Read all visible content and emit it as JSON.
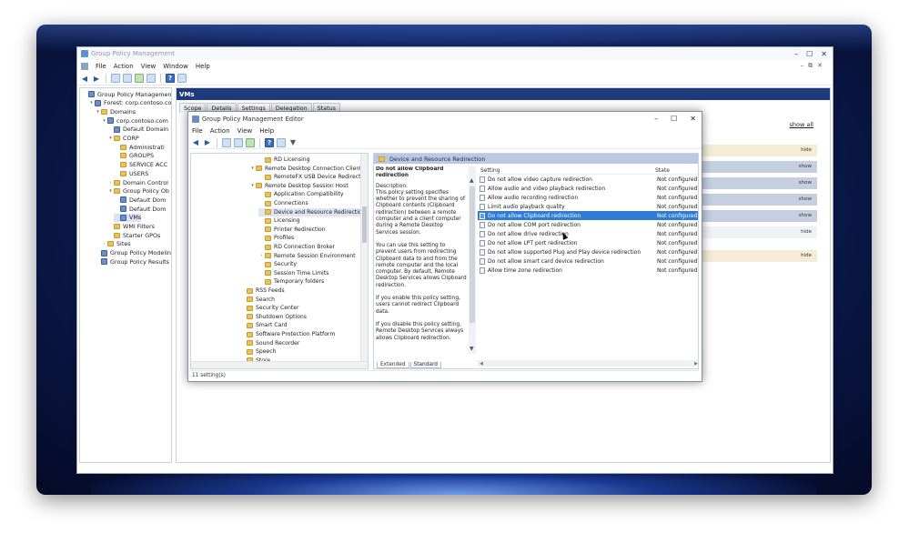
{
  "gpm": {
    "title": "Group Policy Management",
    "menu": [
      "File",
      "Action",
      "View",
      "Window",
      "Help"
    ],
    "tree": [
      {
        "label": "Group Policy Management",
        "icon": "gpm-icon",
        "exp": ""
      },
      {
        "label": "Forest: corp.contoso.com",
        "icon": "forest-icon",
        "exp": "▾"
      },
      {
        "label": "Domains",
        "icon": "folder-icon",
        "exp": "▾"
      },
      {
        "label": "corp.contoso.com",
        "icon": "domain-icon",
        "exp": "▾"
      },
      {
        "label": "Default Domain",
        "icon": "gpo-icon",
        "exp": ""
      },
      {
        "label": "CORP",
        "icon": "folder-icon",
        "exp": "▾"
      },
      {
        "label": "Administrati",
        "icon": "folder-icon",
        "exp": ""
      },
      {
        "label": "GROUPS",
        "icon": "folder-icon",
        "exp": ""
      },
      {
        "label": "SERVICE ACC",
        "icon": "folder-icon",
        "exp": ""
      },
      {
        "label": "USERS",
        "icon": "folder-icon",
        "exp": ""
      },
      {
        "label": "Domain Control",
        "icon": "folder-icon",
        "exp": "›"
      },
      {
        "label": "Group Policy Ob",
        "icon": "folder-icon",
        "exp": "▾"
      },
      {
        "label": "Default Dom",
        "icon": "gpo-icon",
        "exp": ""
      },
      {
        "label": "Default Dom",
        "icon": "gpo-icon",
        "exp": ""
      },
      {
        "label": "VMs",
        "icon": "gpo-icon",
        "exp": ""
      },
      {
        "label": "WMI Filters",
        "icon": "folder-icon",
        "exp": ""
      },
      {
        "label": "Starter GPOs",
        "icon": "folder-icon",
        "exp": ""
      },
      {
        "label": "Sites",
        "icon": "folder-icon",
        "exp": "›"
      },
      {
        "label": "Group Policy Modeling",
        "icon": "gpo-icon",
        "exp": ""
      },
      {
        "label": "Group Policy Results",
        "icon": "gpo-icon",
        "exp": ""
      }
    ],
    "right": {
      "header": "VMs",
      "tabs": [
        "Scope",
        "Details",
        "Settings",
        "Delegation",
        "Status"
      ],
      "active_tab": "Settings",
      "show_all": "show all",
      "report_rows": [
        {
          "text": "hide",
          "kind": "h"
        },
        {
          "text": "show",
          "kind": "b"
        },
        {
          "text": "show",
          "kind": "b"
        },
        {
          "text": "show",
          "kind": "b"
        },
        {
          "text": "show",
          "kind": "b"
        },
        {
          "text": "hide",
          "kind": "w"
        },
        {
          "text": "hide",
          "kind": "h"
        }
      ]
    }
  },
  "gpme": {
    "title": "Group Policy Management Editor",
    "menu": [
      "File",
      "Action",
      "View",
      "Help"
    ],
    "tree": [
      {
        "label": "RD Licensing",
        "indent": 2,
        "exp": ""
      },
      {
        "label": "Remote Desktop Connection Client",
        "indent": 1,
        "exp": "▾"
      },
      {
        "label": "RemoteFX USB Device Redirection",
        "indent": 2,
        "exp": ""
      },
      {
        "label": "Remote Desktop Session Host",
        "indent": 1,
        "exp": "▾"
      },
      {
        "label": "Application Compatibility",
        "indent": 2,
        "exp": ""
      },
      {
        "label": "Connections",
        "indent": 2,
        "exp": ""
      },
      {
        "label": "Device and Resource Redirection",
        "indent": 2,
        "exp": "",
        "selected": true
      },
      {
        "label": "Licensing",
        "indent": 2,
        "exp": ""
      },
      {
        "label": "Printer Redirection",
        "indent": 2,
        "exp": ""
      },
      {
        "label": "Profiles",
        "indent": 2,
        "exp": ""
      },
      {
        "label": "RD Connection Broker",
        "indent": 2,
        "exp": ""
      },
      {
        "label": "Remote Session Environment",
        "indent": 2,
        "exp": "›"
      },
      {
        "label": "Security",
        "indent": 2,
        "exp": ""
      },
      {
        "label": "Session Time Limits",
        "indent": 2,
        "exp": ""
      },
      {
        "label": "Temporary folders",
        "indent": 2,
        "exp": ""
      },
      {
        "label": "RSS Feeds",
        "indent": 0,
        "exp": ""
      },
      {
        "label": "Search",
        "indent": 0,
        "exp": ""
      },
      {
        "label": "Security Center",
        "indent": 0,
        "exp": ""
      },
      {
        "label": "Shutdown Options",
        "indent": 0,
        "exp": ""
      },
      {
        "label": "Smart Card",
        "indent": 0,
        "exp": ""
      },
      {
        "label": "Software Protection Platform",
        "indent": 0,
        "exp": ""
      },
      {
        "label": "Sound Recorder",
        "indent": 0,
        "exp": ""
      },
      {
        "label": "Speech",
        "indent": 0,
        "exp": ""
      },
      {
        "label": "Store",
        "indent": 0,
        "exp": ""
      }
    ],
    "section_title": "Device and Resource Redirection",
    "description": {
      "title": "Do not allow Clipboard redirection",
      "paragraphs": [
        "Description:\nThis policy setting specifies whether to prevent the sharing of Clipboard contents (Clipboard redirection) between a remote computer and a client computer during a Remote Desktop Services session.",
        "You can use this setting to prevent users from redirecting Clipboard data to and from the remote computer and the local computer. By default, Remote Desktop Services allows Clipboard redirection.",
        "If you enable this policy setting, users cannot redirect Clipboard data.",
        "If you disable this policy setting, Remote Desktop Services always allows Clipboard redirection."
      ]
    },
    "columns": {
      "setting": "Setting",
      "state": "State"
    },
    "settings": [
      {
        "name": "Do not allow video capture redirection",
        "state": "Not configured"
      },
      {
        "name": "Allow audio and video playback redirection",
        "state": "Not configured"
      },
      {
        "name": "Allow audio recording redirection",
        "state": "Not configured"
      },
      {
        "name": "Limit audio playback quality",
        "state": "Not configured"
      },
      {
        "name": "Do not allow Clipboard redirection",
        "state": "Not configured",
        "selected": true
      },
      {
        "name": "Do not allow COM port redirection",
        "state": "Not configured"
      },
      {
        "name": "Do not allow drive redirection",
        "state": "Not configured"
      },
      {
        "name": "Do not allow LPT port redirection",
        "state": "Not configured"
      },
      {
        "name": "Do not allow supported Plug and Play device redirection",
        "state": "Not configured"
      },
      {
        "name": "Do not allow smart card device redirection",
        "state": "Not configured"
      },
      {
        "name": "Allow time zone redirection",
        "state": "Not configured"
      }
    ],
    "view_tabs": [
      "Extended",
      "Standard"
    ],
    "active_view_tab": "Extended",
    "status": "11 setting(s)"
  },
  "colors": {
    "selection": "#2f7bd6",
    "header_dark": "#1f3a7a",
    "section_header": "#b9c9e2"
  }
}
